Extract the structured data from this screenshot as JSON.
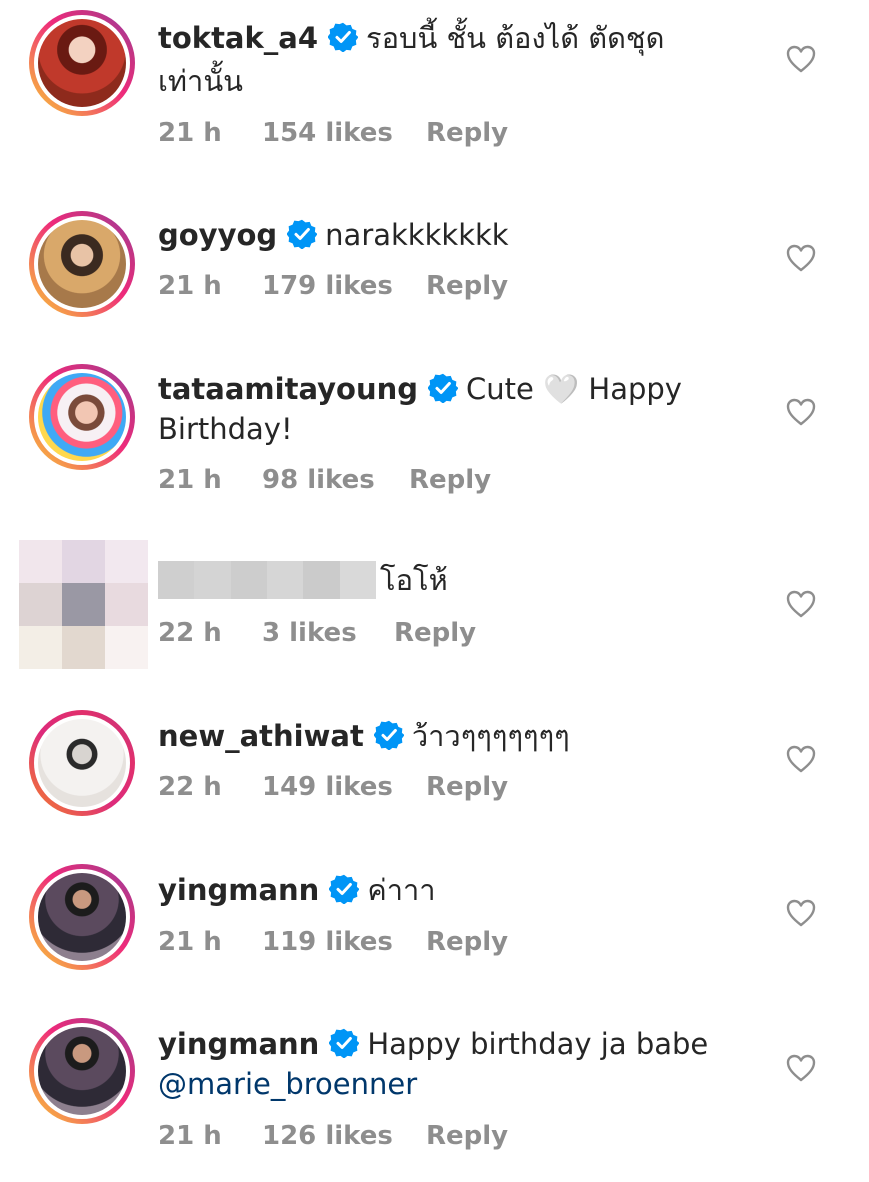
{
  "comments": [
    {
      "username": "toktak_a4",
      "text_line1": "รอบนี้ ชั้น ต้องได้ ตัดชุด",
      "text_line2": "เท่านั้น",
      "time": "21 h",
      "likes": "154 likes",
      "reply": "Reply",
      "verified": true
    },
    {
      "username": "goyyog",
      "text_line1": "narakkkkkkk",
      "time": "21 h",
      "likes": "179 likes",
      "reply": "Reply",
      "verified": true
    },
    {
      "username": "tataamitayoung",
      "text_line1": "Cute 🤍 Happy",
      "text_line2": "Birthday!",
      "time": "21 h",
      "likes": "98 likes",
      "reply": "Reply",
      "verified": true
    },
    {
      "username": "",
      "text_line1": "โอโห้",
      "time": "22 h",
      "likes": "3 likes",
      "reply": "Reply",
      "verified": false,
      "redacted": true
    },
    {
      "username": "new_athiwat",
      "text_line1": "ว้าวๆๆๆๆๆๆๆ",
      "time": "22 h",
      "likes": "149 likes",
      "reply": "Reply",
      "verified": true
    },
    {
      "username": "yingmann",
      "text_line1": "ค่าาา",
      "time": "21 h",
      "likes": "119 likes",
      "reply": "Reply",
      "verified": true
    },
    {
      "username": "yingmann",
      "text_line1": "Happy birthday ja babe",
      "text_line2": "@marie_broenner",
      "time": "21 h",
      "likes": "126 likes",
      "reply": "Reply",
      "verified": true
    }
  ],
  "icons": {
    "verified": "verified-badge-icon",
    "like": "heart-outline-icon"
  },
  "colors": {
    "verified_blue": "#0095f6",
    "meta_gray": "#8e8e8e",
    "mention_blue": "#00376b",
    "text": "#262626"
  }
}
